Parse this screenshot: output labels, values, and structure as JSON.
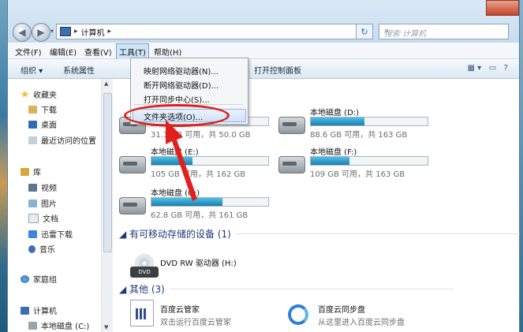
{
  "window": {
    "address_crumb": "计算机",
    "search_placeholder": "搜索 计算机"
  },
  "menubar": {
    "items": [
      {
        "label": "文件(F)"
      },
      {
        "label": "编辑(E)"
      },
      {
        "label": "查看(V)"
      },
      {
        "label": "工具(T)",
        "active": true
      },
      {
        "label": "帮助(H)"
      }
    ]
  },
  "toolbar": {
    "organize": "组织 ▾",
    "system_properties": "系统属性",
    "open_control_panel": "打开控制面板"
  },
  "tools_menu": {
    "items": [
      {
        "label": "映射网络驱动器(N)..."
      },
      {
        "label": "断开网络驱动器(D)..."
      },
      {
        "label": "打开同步中心(S)..."
      },
      {
        "label": "文件夹选项(O)...",
        "highlighted": true
      }
    ]
  },
  "sidebar": {
    "favorites": "收藏夹",
    "downloads": "下载",
    "desktop": "桌面",
    "recent": "最近访问的位置",
    "libraries": "库",
    "videos": "视频",
    "pictures": "图片",
    "documents": "文档",
    "xunlei": "迅雷下载",
    "music": "音乐",
    "homegroup": "家庭组",
    "computer": "计算机",
    "local_c": "本地磁盘 (C:)"
  },
  "drives": [
    {
      "name": "",
      "size_text": "31.1 GB 可用，共 50.0 GB",
      "fill": 0.38
    },
    {
      "name": "本地磁盘 (D:)",
      "size_text": "88.6 GB 可用，共 163 GB",
      "fill": 0.46
    },
    {
      "name": "本地磁盘 (E:)",
      "size_text": "105 GB 可用，共 162 GB",
      "fill": 0.35
    },
    {
      "name": "本地磁盘 (F:)",
      "size_text": "109 GB 可用，共 163 GB",
      "fill": 0.33
    },
    {
      "name": "本地磁盘 (G:)",
      "size_text": "62.8 GB 可用，共 161 GB",
      "fill": 0.61
    }
  ],
  "sections": {
    "removable": "有可移动存储的设备 (1)",
    "dvd": "DVD RW 驱动器 (H:)",
    "other": "其他 (3)"
  },
  "other_items": [
    {
      "name": "百度云管家",
      "desc": "双击运行百度云管家"
    },
    {
      "name": "百度云同步盘",
      "desc": "从这里进入百度云同步盘"
    }
  ]
}
